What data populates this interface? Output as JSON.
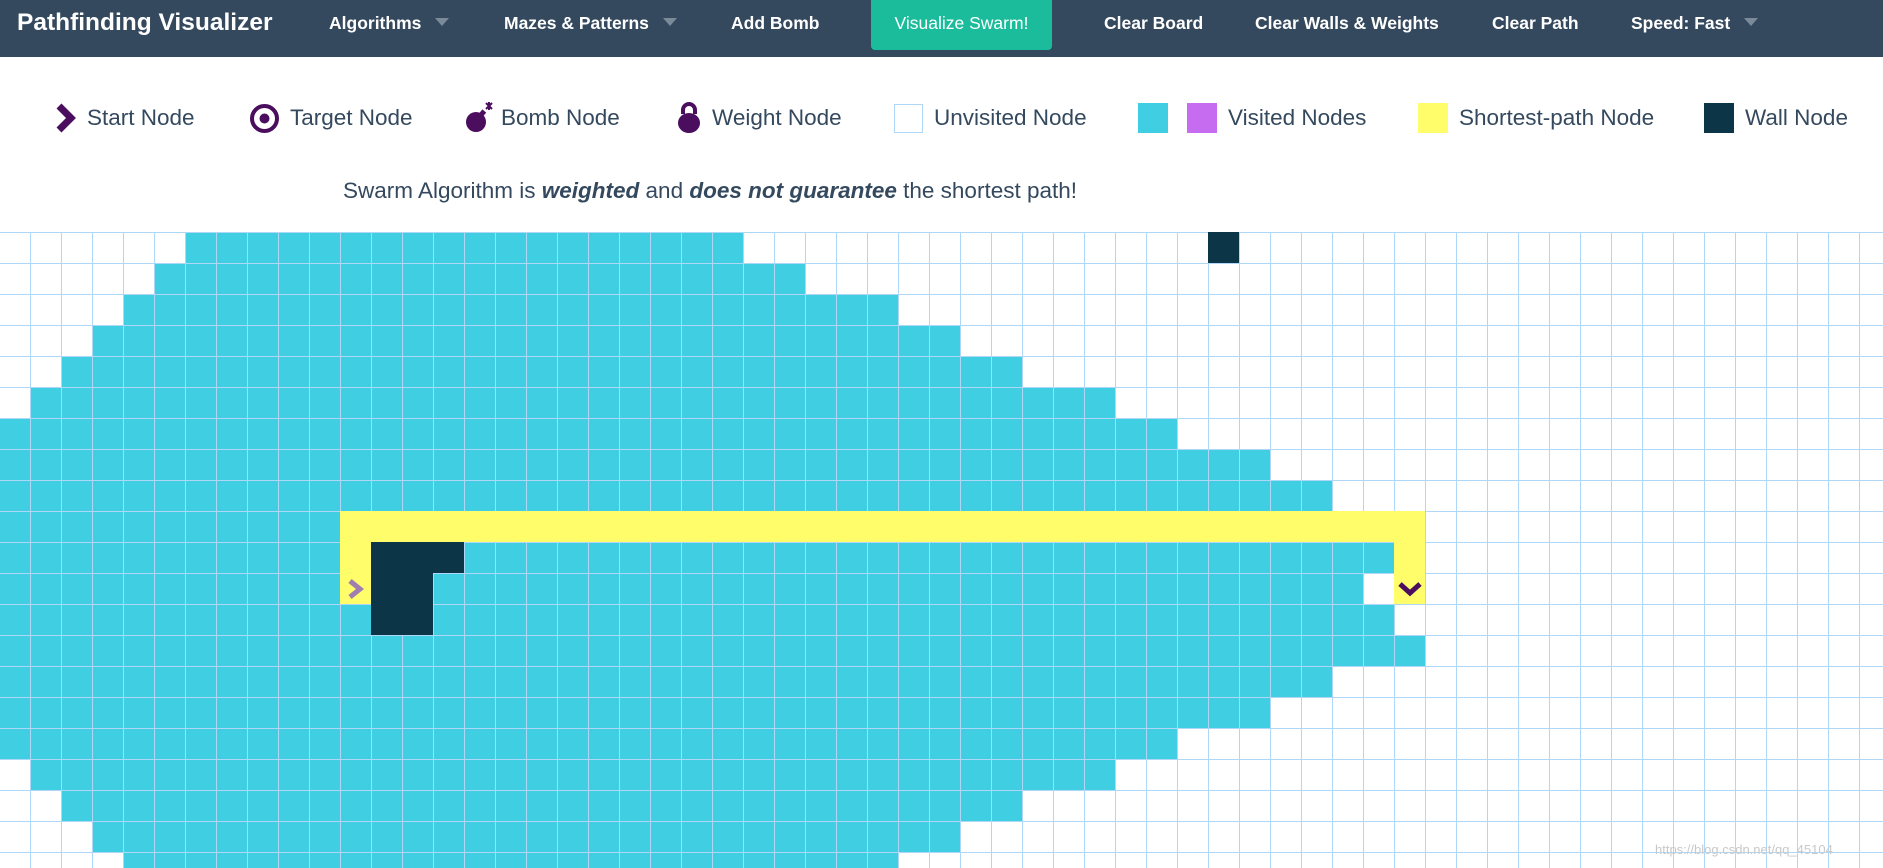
{
  "app_title": "Pathfinding Visualizer",
  "nav": {
    "algorithms": "Algorithms",
    "mazes": "Mazes & Patterns",
    "add_bomb": "Add Bomb",
    "visualize": "Visualize Swarm!",
    "clear_board": "Clear Board",
    "clear_walls_weights": "Clear Walls & Weights",
    "clear_path": "Clear Path",
    "speed": "Speed: Fast"
  },
  "legend": {
    "start": "Start Node",
    "target": "Target Node",
    "bomb": "Bomb Node",
    "weight": "Weight Node",
    "unvisited": "Unvisited Node",
    "visited": "Visited Nodes",
    "shortest": "Shortest-path Node",
    "wall": "Wall Node"
  },
  "description": {
    "prefix": "Swarm Algorithm is ",
    "weighted": "weighted",
    "middle": " and ",
    "no_guarantee": "does not guarantee",
    "suffix": " the shortest path!"
  },
  "colors": {
    "navbar": "#34495e",
    "accent": "#1abc9c",
    "visited": "#40cee3",
    "visited_alt": "#c56cf0",
    "shortest_path": "#fffe6a",
    "wall": "#0c3547",
    "grid_line": "#afd8f8",
    "node_icon": "#4b0e5e"
  },
  "icons": {
    "start": "chevron-right-icon",
    "target": "bullseye-icon",
    "bomb": "bomb-icon",
    "weight": "kettlebell-icon"
  },
  "grid": {
    "rows": 21,
    "cols": 61,
    "start_node": {
      "row": 11,
      "col": 11
    },
    "target_node": {
      "row": 11,
      "col": 45
    },
    "visited_rows": [
      {
        "row": 0,
        "from": 6,
        "to": 23
      },
      {
        "row": 1,
        "from": 5,
        "to": 25
      },
      {
        "row": 2,
        "from": 4,
        "to": 28
      },
      {
        "row": 3,
        "from": 3,
        "to": 30
      },
      {
        "row": 4,
        "from": 2,
        "to": 32
      },
      {
        "row": 5,
        "from": 1,
        "to": 35
      },
      {
        "row": 6,
        "from": 0,
        "to": 37
      },
      {
        "row": 7,
        "from": 0,
        "to": 40
      },
      {
        "row": 8,
        "from": 0,
        "to": 42
      },
      {
        "row": 9,
        "from": 0,
        "to": 45
      },
      {
        "row": 10,
        "from": 0,
        "to": 44
      },
      {
        "row": 11,
        "from": 0,
        "to": 43
      },
      {
        "row": 12,
        "from": 0,
        "to": 44
      },
      {
        "row": 13,
        "from": 0,
        "to": 45
      },
      {
        "row": 14,
        "from": 0,
        "to": 42
      },
      {
        "row": 15,
        "from": 0,
        "to": 40
      },
      {
        "row": 16,
        "from": 0,
        "to": 37
      },
      {
        "row": 17,
        "from": 1,
        "to": 35
      },
      {
        "row": 18,
        "from": 2,
        "to": 32
      },
      {
        "row": 19,
        "from": 3,
        "to": 30
      },
      {
        "row": 20,
        "from": 4,
        "to": 28
      }
    ],
    "walls": [
      {
        "row": 0,
        "col": 39
      },
      {
        "row": 10,
        "col": 12
      },
      {
        "row": 10,
        "col": 13
      },
      {
        "row": 10,
        "col": 14
      },
      {
        "row": 11,
        "col": 12
      },
      {
        "row": 11,
        "col": 13
      },
      {
        "row": 12,
        "col": 12
      },
      {
        "row": 12,
        "col": 13
      }
    ],
    "shortest_path": [
      {
        "row": 11,
        "col": 11
      },
      {
        "row": 10,
        "col": 11
      },
      {
        "row": 9,
        "col": 11
      },
      {
        "row": 9,
        "col": 12
      },
      {
        "row": 9,
        "col": 13
      },
      {
        "row": 9,
        "col": 14
      },
      {
        "row": 9,
        "col": 15
      },
      {
        "row": 9,
        "col": 16
      },
      {
        "row": 9,
        "col": 17
      },
      {
        "row": 9,
        "col": 18
      },
      {
        "row": 9,
        "col": 19
      },
      {
        "row": 9,
        "col": 20
      },
      {
        "row": 9,
        "col": 21
      },
      {
        "row": 9,
        "col": 22
      },
      {
        "row": 9,
        "col": 23
      },
      {
        "row": 9,
        "col": 24
      },
      {
        "row": 9,
        "col": 25
      },
      {
        "row": 9,
        "col": 26
      },
      {
        "row": 9,
        "col": 27
      },
      {
        "row": 9,
        "col": 28
      },
      {
        "row": 9,
        "col": 29
      },
      {
        "row": 9,
        "col": 30
      },
      {
        "row": 9,
        "col": 31
      },
      {
        "row": 9,
        "col": 32
      },
      {
        "row": 9,
        "col": 33
      },
      {
        "row": 9,
        "col": 34
      },
      {
        "row": 9,
        "col": 35
      },
      {
        "row": 9,
        "col": 36
      },
      {
        "row": 9,
        "col": 37
      },
      {
        "row": 9,
        "col": 38
      },
      {
        "row": 9,
        "col": 39
      },
      {
        "row": 9,
        "col": 40
      },
      {
        "row": 9,
        "col": 41
      },
      {
        "row": 9,
        "col": 42
      },
      {
        "row": 9,
        "col": 43
      },
      {
        "row": 9,
        "col": 44
      },
      {
        "row": 9,
        "col": 45
      },
      {
        "row": 10,
        "col": 45
      },
      {
        "row": 11,
        "col": 45
      }
    ],
    "unvisited_cells": [
      {
        "row": 11,
        "col": 44
      }
    ]
  },
  "watermark": "https://blog.csdn.net/qq_45104"
}
